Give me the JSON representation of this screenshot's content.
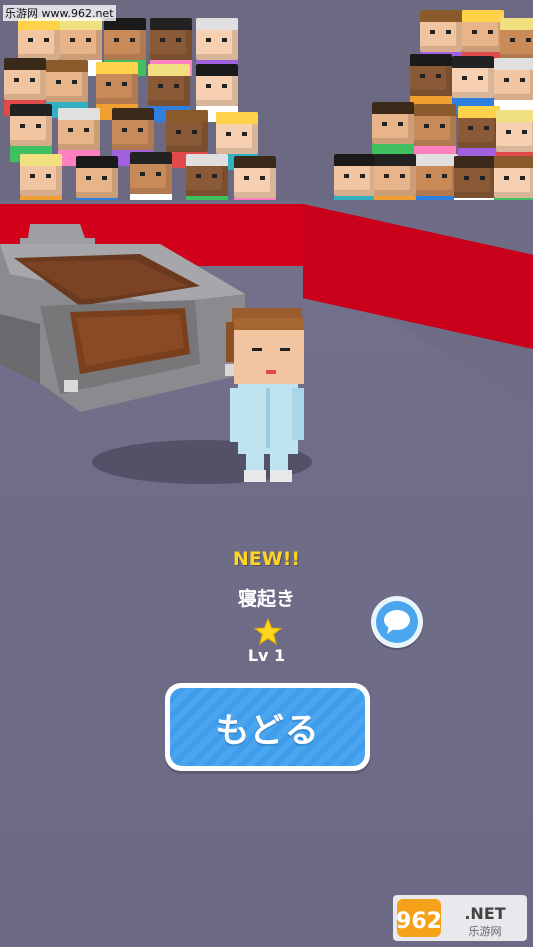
{
  "watermark": {
    "top_text": "乐游网 www.962.net",
    "logo_text": "962.NET",
    "logo_sub": "乐游网"
  },
  "result": {
    "badge": "NEW!!",
    "item_name": "寝起き",
    "level": "Lv 1",
    "stars": 1
  },
  "buttons": {
    "back_label": "もどる"
  },
  "icons": {
    "chat": "chat-bubble-icon",
    "star": "star-icon"
  },
  "colors": {
    "accent_yellow": "#ffd51f",
    "button_blue": "#4aa6ef",
    "arena_red": "#d1001b",
    "floor": "#6f6d86"
  }
}
